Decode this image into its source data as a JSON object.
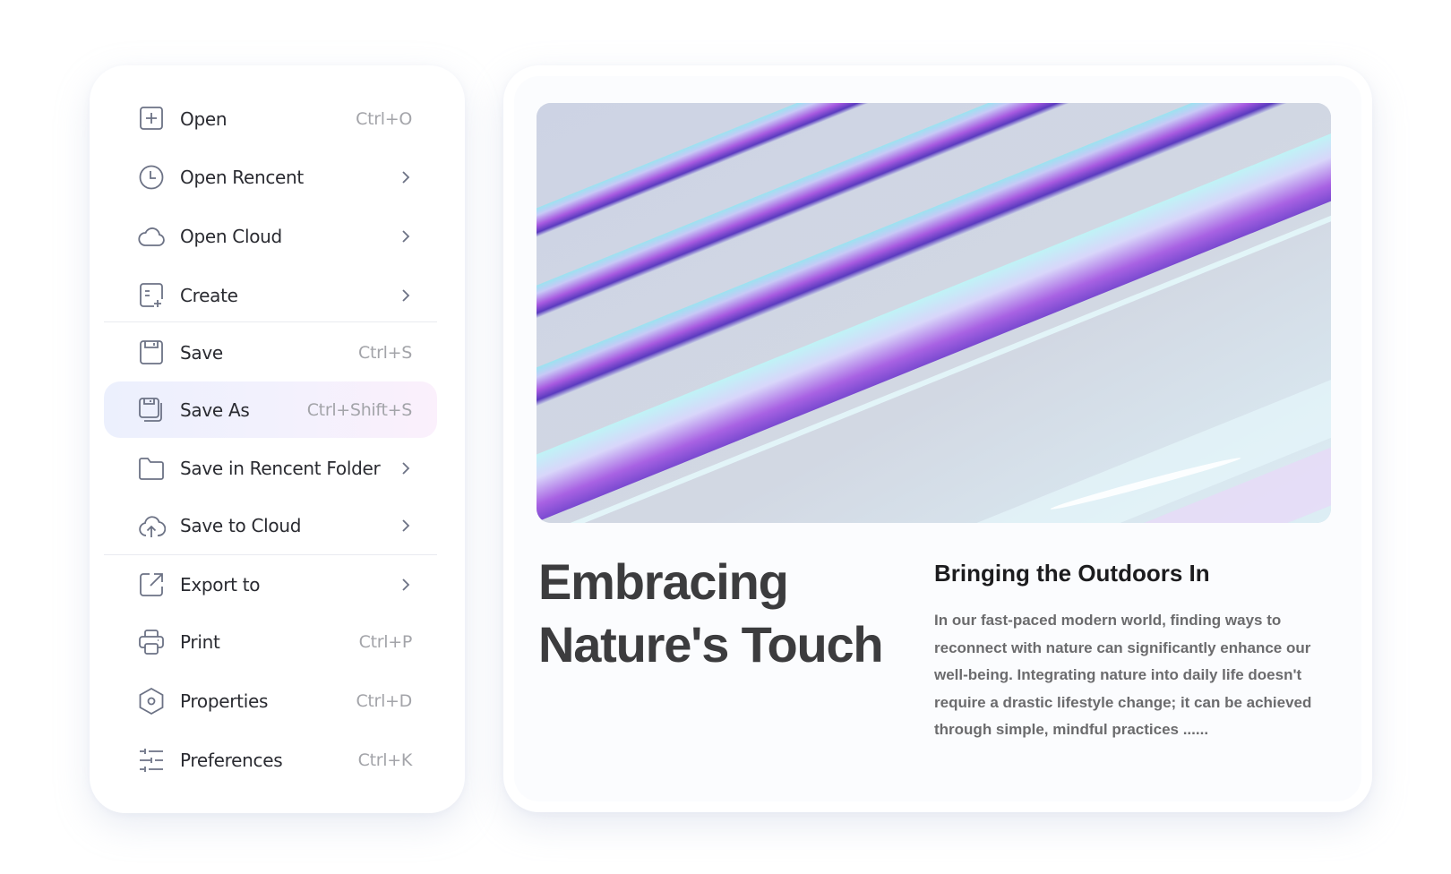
{
  "menu": {
    "items": [
      {
        "label": "Open",
        "shortcut": "Ctrl+O",
        "icon": "plus-square-icon",
        "submenu": false
      },
      {
        "label": "Open Rencent",
        "shortcut": "",
        "icon": "clock-icon",
        "submenu": true
      },
      {
        "label": "Open Cloud",
        "shortcut": "",
        "icon": "cloud-icon",
        "submenu": true
      },
      {
        "label": "Create",
        "shortcut": "",
        "icon": "create-document-icon",
        "submenu": true
      },
      {
        "label": "Save",
        "shortcut": "Ctrl+S",
        "icon": "floppy-disk-icon",
        "submenu": false
      },
      {
        "label": "Save As",
        "shortcut": "Ctrl+Shift+S",
        "icon": "save-as-icon",
        "submenu": false,
        "active": true
      },
      {
        "label": "Save in Rencent Folder",
        "shortcut": "",
        "icon": "folder-icon",
        "submenu": true
      },
      {
        "label": "Save to Cloud",
        "shortcut": "",
        "icon": "cloud-upload-icon",
        "submenu": true
      },
      {
        "label": "Export to",
        "shortcut": "",
        "icon": "export-icon",
        "submenu": true
      },
      {
        "label": "Print",
        "shortcut": "Ctrl+P",
        "icon": "printer-icon",
        "submenu": false
      },
      {
        "label": "Properties",
        "shortcut": "Ctrl+D",
        "icon": "hexagon-settings-icon",
        "submenu": false
      },
      {
        "label": "Preferences",
        "shortcut": "Ctrl+K",
        "icon": "sliders-icon",
        "submenu": false
      }
    ]
  },
  "article": {
    "title_line1": "Embracing",
    "title_line2": "Nature's Touch",
    "subheading": "Bringing the Outdoors In",
    "body": "In our fast-paced modern world, finding ways to reconnect with nature can significantly enhance our well-being. Integrating nature into daily life doesn't require a drastic lifestyle change; it can be achieved through simple, mindful practices ......",
    "image_alt": "abstract iridescent purple and cyan diagonal stripes"
  },
  "colors": {
    "highlight_start": "#ecf0fd",
    "highlight_end": "#fbf0fc",
    "icon_stroke": "#6c7285",
    "text_primary": "#2a2b31",
    "text_muted": "#a3a4a9"
  }
}
